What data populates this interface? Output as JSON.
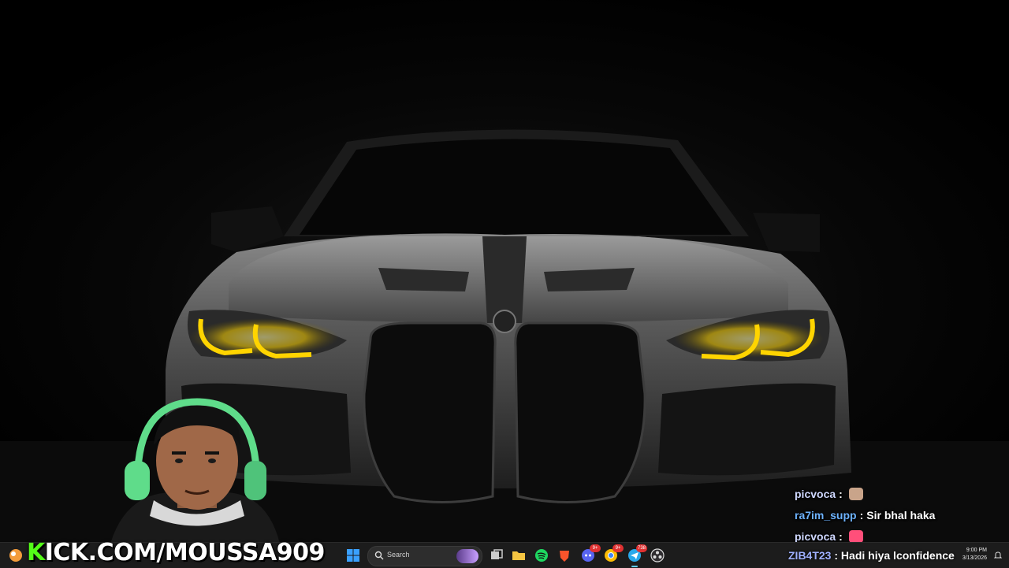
{
  "brand": {
    "prefix": "K",
    "text": "ICK.COM/MOUSSA909",
    "accent": "#53fc18"
  },
  "chat": {
    "messages": [
      {
        "user": "picvoca",
        "sep": ":",
        "text": "",
        "emote": "hamster-emote"
      },
      {
        "user": "ra7im_supp",
        "sep": ":",
        "text": "Sir bhal haka",
        "emote": ""
      },
      {
        "user": "picvoca",
        "sep": ":",
        "text": "",
        "emote": "pink-heart-emote"
      }
    ],
    "last": {
      "user": "ZIB4T23",
      "sep": ":",
      "text": "Hadi hiya lconfidence"
    }
  },
  "taskbar": {
    "search_placeholder": "Search",
    "pinned": [
      {
        "name": "task-view-icon"
      },
      {
        "name": "file-explorer-icon"
      },
      {
        "name": "spotify-icon"
      },
      {
        "name": "brave-browser-icon"
      },
      {
        "name": "discord-icon",
        "badge": "9+"
      },
      {
        "name": "chrome-icon",
        "badge": "9+"
      },
      {
        "name": "telegram-icon",
        "badge": "738"
      },
      {
        "name": "obs-icon"
      }
    ],
    "time": "9:00 PM",
    "date": "3/13/2026"
  },
  "colors": {
    "headlight": "#ffd400",
    "taskbar_bg": "#1c1c1c"
  }
}
